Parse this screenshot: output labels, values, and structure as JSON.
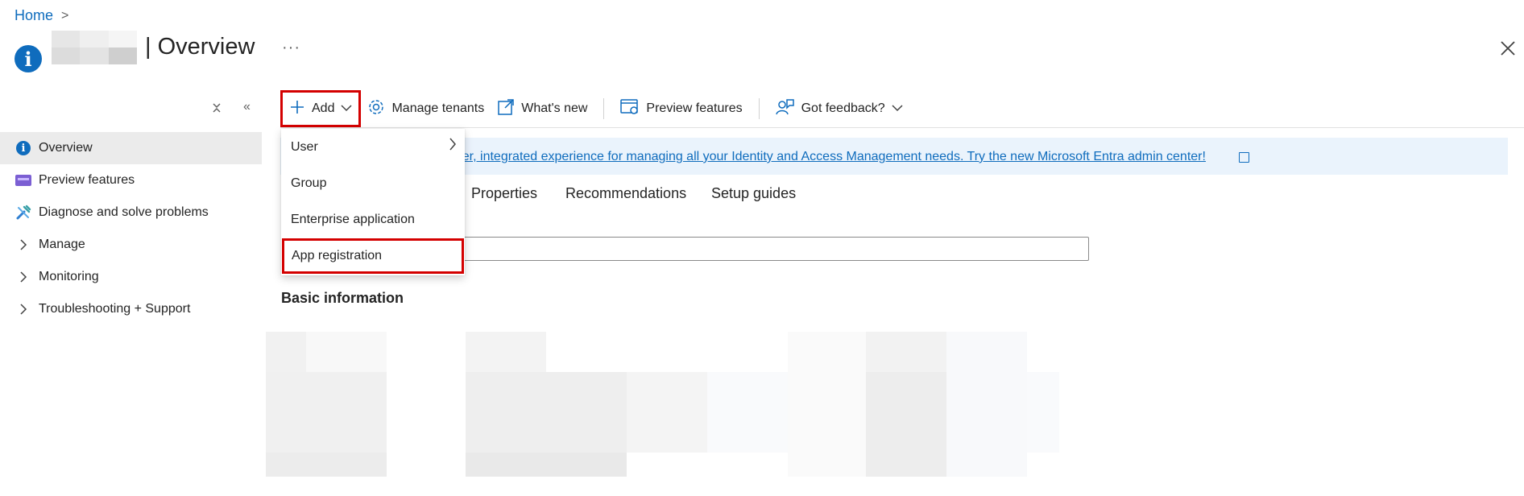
{
  "breadcrumb": {
    "home": "Home",
    "separator": ">"
  },
  "header": {
    "title": "| Overview",
    "more": "···",
    "info_icon_glyph": "i"
  },
  "sidebar": {
    "collapse_glyph": "«",
    "expand_glyph": "⌃",
    "items": [
      {
        "label": "Overview",
        "icon": "info-icon",
        "active": true
      },
      {
        "label": "Preview features",
        "icon": "preview-icon"
      },
      {
        "label": "Diagnose and solve problems",
        "icon": "wrench-icon"
      },
      {
        "label": "Manage",
        "icon": "chevron-right-icon"
      },
      {
        "label": "Monitoring",
        "icon": "chevron-right-icon"
      },
      {
        "label": "Troubleshooting + Support",
        "icon": "chevron-right-icon"
      }
    ]
  },
  "toolbar": {
    "add": "Add",
    "manage_tenants": "Manage tenants",
    "whats_new": "What's new",
    "preview_features": "Preview features",
    "got_feedback": "Got feedback?"
  },
  "banner": {
    "text": "mpler, integrated experience for managing all your Identity and Access Management needs. Try the new Microsoft Entra admin center!"
  },
  "tabs": [
    "Properties",
    "Recommendations",
    "Setup guides"
  ],
  "main": {
    "section_title": "Basic information"
  },
  "dropdown": {
    "items": [
      {
        "label": "User",
        "has_submenu": true
      },
      {
        "label": "Group"
      },
      {
        "label": "Enterprise application"
      },
      {
        "label": "App registration",
        "highlighted": true
      }
    ]
  },
  "colors": {
    "accent": "#0f6cbd",
    "highlight_border": "#d40000"
  }
}
